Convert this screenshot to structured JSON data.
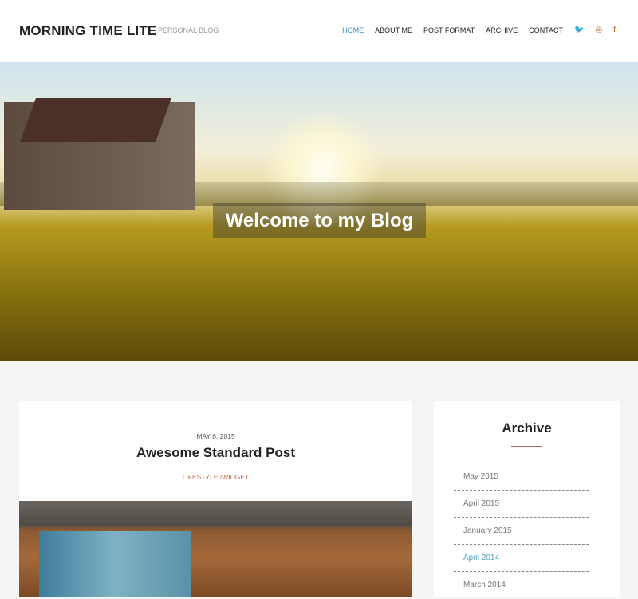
{
  "header": {
    "logo": "MORNING TIME LITE",
    "tagline": "PERSONAL BLOG",
    "nav": [
      "HOME",
      "ABOUT ME",
      "POST FORMAT",
      "ARCHIVE",
      "CONTACT"
    ],
    "social": [
      {
        "icon": "twitter-icon",
        "glyph": "🐦"
      },
      {
        "icon": "dribbble-icon",
        "glyph": "◎"
      },
      {
        "icon": "facebook-icon",
        "glyph": "f"
      }
    ]
  },
  "hero": {
    "title": "Welcome to my Blog"
  },
  "post": {
    "date": "MAY 6, 2015",
    "title": "Awesome Standard Post",
    "categories": "LIFESTYLE  /WIDGET"
  },
  "sidebar": {
    "title": "Archive",
    "items": [
      "May 2015",
      "April 2015",
      "January 2015",
      "April 2014",
      "March 2014"
    ]
  },
  "colors": {
    "accent": "#3b8ac9",
    "category": "#c0673f"
  }
}
